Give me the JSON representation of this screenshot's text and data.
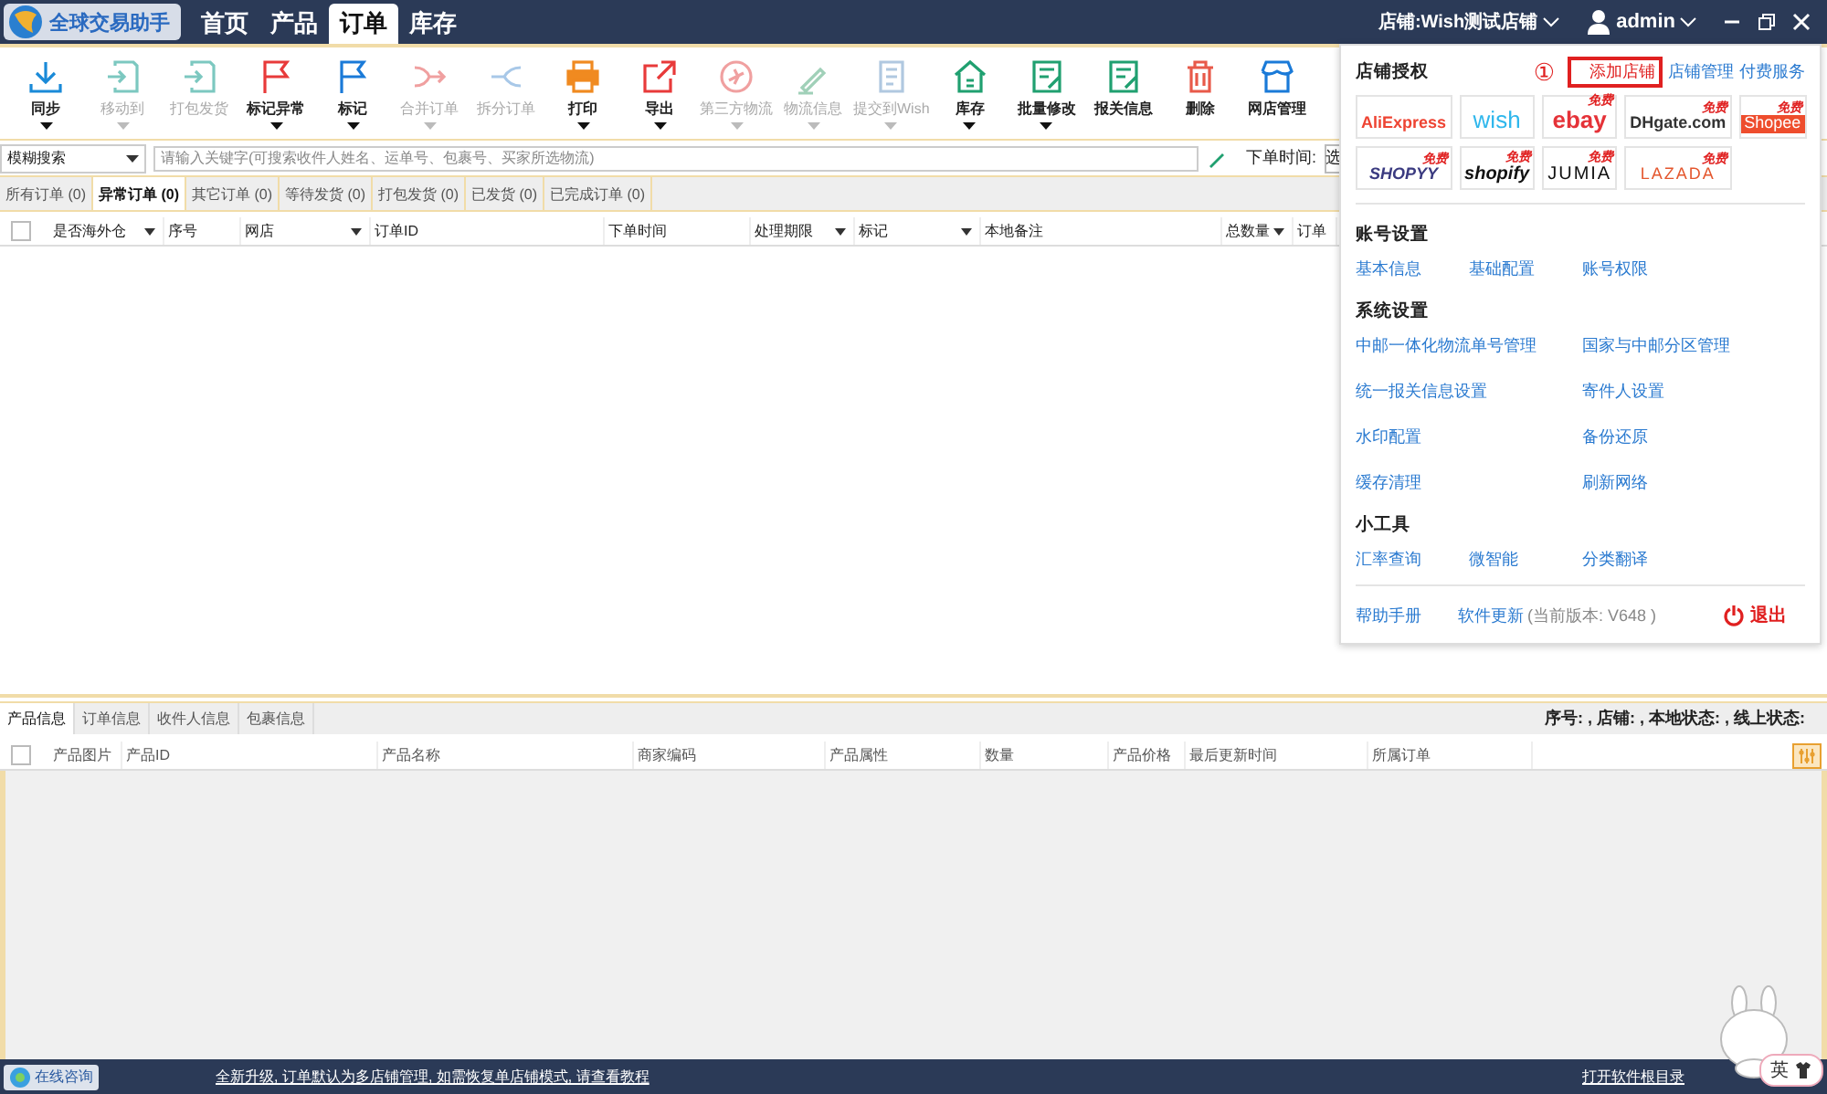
{
  "app": {
    "logo_text": "全球交易助手"
  },
  "nav_tabs": [
    {
      "label": "首页",
      "selected": false
    },
    {
      "label": "产品",
      "selected": false
    },
    {
      "label": "订单",
      "selected": true
    },
    {
      "label": "库存",
      "selected": false
    }
  ],
  "top_right": {
    "store_label": "店铺:",
    "store_name": "Wish测试店铺",
    "user": "admin"
  },
  "toolbar": [
    {
      "label": "同步",
      "kind": "download",
      "disabled": false,
      "dropdown": true
    },
    {
      "label": "移动到",
      "kind": "move",
      "disabled": true,
      "dropdown": true
    },
    {
      "label": "打包发货",
      "kind": "move",
      "disabled": true,
      "dropdown": false
    },
    {
      "label": "标记异常",
      "kind": "flagred",
      "disabled": false,
      "dropdown": true
    },
    {
      "label": "标记",
      "kind": "flagblue",
      "disabled": false,
      "dropdown": true
    },
    {
      "label": "合并订单",
      "kind": "merge",
      "disabled": true,
      "dropdown": true
    },
    {
      "label": "拆分订单",
      "kind": "split",
      "disabled": true,
      "dropdown": false
    },
    {
      "label": "打印",
      "kind": "print",
      "disabled": false,
      "dropdown": true
    },
    {
      "label": "导出",
      "kind": "export",
      "disabled": false,
      "dropdown": true
    },
    {
      "label": "第三方物流",
      "kind": "plane",
      "disabled": true,
      "dropdown": true
    },
    {
      "label": "物流信息",
      "kind": "pen",
      "disabled": true,
      "dropdown": true
    },
    {
      "label": "提交到Wish",
      "kind": "doc",
      "disabled": true,
      "dropdown": true
    },
    {
      "label": "库存",
      "kind": "house",
      "disabled": false,
      "dropdown": true
    },
    {
      "label": "批量修改",
      "kind": "sheet",
      "disabled": false,
      "dropdown": true
    },
    {
      "label": "报关信息",
      "kind": "sheet",
      "disabled": false,
      "dropdown": false
    },
    {
      "label": "删除",
      "kind": "trash",
      "disabled": false,
      "dropdown": false
    },
    {
      "label": "网店管理",
      "kind": "store",
      "disabled": false,
      "dropdown": false
    }
  ],
  "search": {
    "mode": "模糊搜索",
    "placeholder": "请输入关键字(可搜索收件人姓名、运单号、包裹号、买家所选物流)",
    "date_label": "下单时间:",
    "date_value": "选"
  },
  "order_tabs": [
    {
      "label": "所有订单 (0)",
      "selected": false
    },
    {
      "label": "异常订单 (0)",
      "selected": true
    },
    {
      "label": "其它订单 (0)",
      "selected": false
    },
    {
      "label": "等待发货 (0)",
      "selected": false
    },
    {
      "label": "打包发货 (0)",
      "selected": false
    },
    {
      "label": "已发货 (0)",
      "selected": false
    },
    {
      "label": "已完成订单 (0)",
      "selected": false
    }
  ],
  "orders_header_checkbox": {
    "checked": false
  },
  "order_columns": [
    {
      "label": "是否海外仓",
      "filter": true
    },
    {
      "label": "序号",
      "filter": false
    },
    {
      "label": "网店",
      "filter": true
    },
    {
      "label": "订单ID",
      "filter": false
    },
    {
      "label": "下单时间",
      "filter": false
    },
    {
      "label": "处理期限",
      "filter": true
    },
    {
      "label": "标记",
      "filter": true
    },
    {
      "label": "本地备注",
      "filter": false
    },
    {
      "label": "总数量",
      "filter": true
    },
    {
      "label": "订单",
      "filter": false
    }
  ],
  "detail_tabs": [
    {
      "label": "产品信息",
      "selected": true
    },
    {
      "label": "订单信息",
      "selected": false
    },
    {
      "label": "收件人信息",
      "selected": false
    },
    {
      "label": "包裹信息",
      "selected": false
    }
  ],
  "detail_status": "序号: , 店铺: , 本地状态: , 线上状态:",
  "products_header_checkbox": {
    "checked": false
  },
  "product_columns": [
    "产品图片",
    "产品ID",
    "产品名称",
    "商家编码",
    "产品属性",
    "数量",
    "产品价格",
    "最后更新时间",
    "所属订单"
  ],
  "menu": {
    "sections": [
      {
        "title": "店铺授权",
        "kind": "stores",
        "step_mark": "①",
        "links": [
          {
            "label": "添加店铺",
            "highlighted": true
          },
          {
            "label": "店铺管理",
            "highlighted": false
          },
          {
            "label": "付费服务",
            "highlighted": false
          }
        ],
        "stores": [
          {
            "name": "AliExpress"
          },
          {
            "name": "wish"
          },
          {
            "name": "ebay",
            "badge": "免费"
          },
          {
            "name": "DHgate.com",
            "badge": "免费"
          },
          {
            "name": "Shopee",
            "badge": "免费"
          },
          {
            "name": "SHOPYY",
            "badge": "免费"
          },
          {
            "name": "shopify",
            "badge": "免费"
          },
          {
            "name": "JUMIA",
            "badge": "免费"
          },
          {
            "name": "LAZADA",
            "badge": "免费"
          }
        ]
      },
      {
        "title": "账号设置",
        "kind": "links",
        "items": [
          "基本信息",
          "基础配置",
          "账号权限"
        ]
      },
      {
        "title": "系统设置",
        "kind": "links",
        "items": [
          "中邮一体化物流单号管理",
          "国家与中邮分区管理",
          "统一报关信息设置",
          "寄件人设置",
          "水印配置",
          "备份还原",
          "缓存清理",
          "刷新网络"
        ]
      },
      {
        "title": "小工具",
        "kind": "links",
        "items": [
          "汇率查询",
          "微智能",
          "分类翻译"
        ]
      }
    ],
    "footer": {
      "help": "帮助手册",
      "update": "软件更新",
      "version": "(当前版本: V648 )",
      "logout": "退出"
    }
  },
  "status_bar": {
    "consult": "在线咨询",
    "notice": "全新升级, 订单默认为多店铺管理, 如需恢复单店铺模式, 请查看教程",
    "open_dir": "打开软件根目录"
  },
  "mascot": {
    "lang": "英"
  }
}
